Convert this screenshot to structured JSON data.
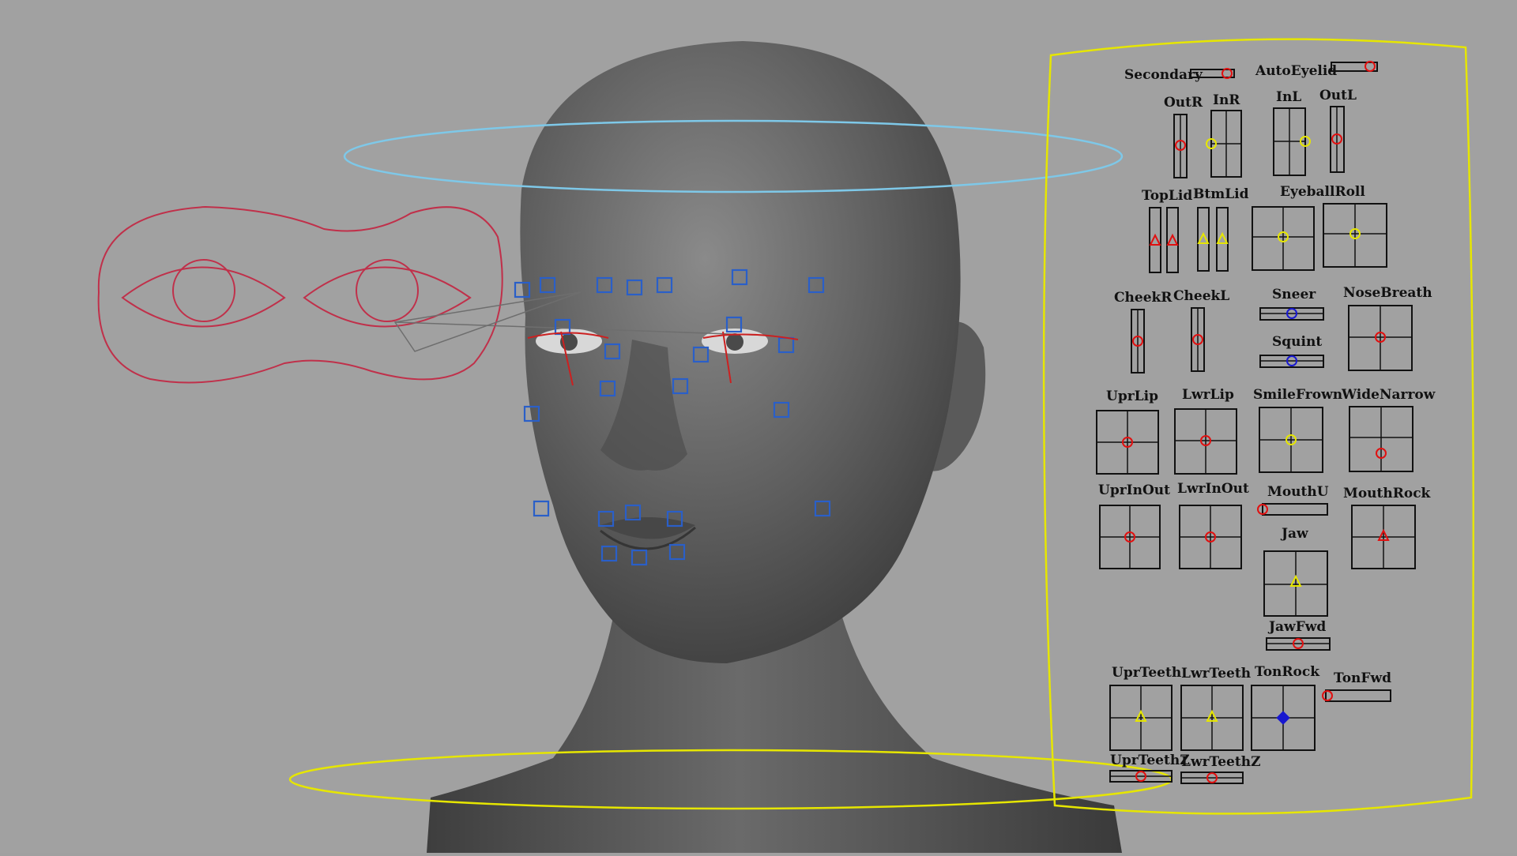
{
  "scene": {
    "description_free_labels": true
  },
  "colors": {
    "viewport_bg": "#a1a1a1",
    "head_ring": "#7ec8e8",
    "neck_ring": "#e6e600",
    "eye_control": "#c0304a",
    "locator": "#2a5fc8",
    "panel_border": "#e6e600",
    "handle_red": "#e01010",
    "handle_yellow": "#e6e600",
    "handle_blue": "#1818d0"
  },
  "panel": {
    "secondary": "Secondary",
    "auto_eyelid": "AutoEyelid",
    "out_r": "OutR",
    "in_r": "InR",
    "in_l": "InL",
    "out_l": "OutL",
    "top_lid": "TopLid",
    "btm_lid": "BtmLid",
    "eyeball_roll": "EyeballRoll",
    "cheek_r": "CheekR",
    "cheek_l": "CheekL",
    "sneer": "Sneer",
    "squint": "Squint",
    "nose_breath": "NoseBreath",
    "upr_lip": "UprLip",
    "lwr_lip": "LwrLip",
    "smile_frown": "SmileFrown",
    "wide_narrow": "WideNarrow",
    "upr_in_out": "UprInOut",
    "lwr_in_out": "LwrInOut",
    "mouth_u": "MouthU",
    "mouth_rock": "MouthRock",
    "jaw": "Jaw",
    "jaw_fwd": "JawFwd",
    "upr_teeth": "UprTeeth",
    "lwr_teeth": "LwrTeeth",
    "ton_rock": "TonRock",
    "ton_fwd": "TonFwd",
    "upr_teeth_z": "UprTeethZ",
    "lwr_teeth_z": "LwrTeethZ"
  }
}
